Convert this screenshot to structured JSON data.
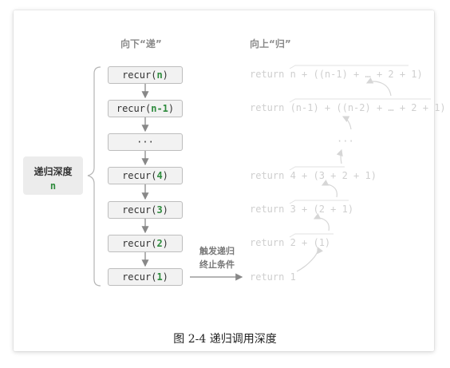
{
  "headers": {
    "down": "向下“递”",
    "up": "向上“归”"
  },
  "depth": {
    "label": "递归深度",
    "value": "n"
  },
  "calls": [
    {
      "prefix": "recur(",
      "arg": "n",
      "suffix": ")"
    },
    {
      "prefix": "recur(",
      "arg": "n-1",
      "suffix": ")"
    },
    {
      "prefix": "",
      "arg": "",
      "suffix": "···"
    },
    {
      "prefix": "recur(",
      "arg": "4",
      "suffix": ")"
    },
    {
      "prefix": "recur(",
      "arg": "3",
      "suffix": ")"
    },
    {
      "prefix": "recur(",
      "arg": "2",
      "suffix": ")"
    },
    {
      "prefix": "recur(",
      "arg": "1",
      "suffix": ")"
    }
  ],
  "returns": [
    "return n + ((n-1) + … + 2 + 1)",
    "return (n-1) + ((n-2) + … + 2 + 1)",
    "···",
    "return 4 + (3 + 2 + 1)",
    "return 3 + (2 + 1)",
    "return 2 + (1)",
    "return 1"
  ],
  "trigger": {
    "line1": "触发递归",
    "line2": "终止条件"
  },
  "caption": "图 2-4   递归调用深度",
  "colors": {
    "accent_green": "#2e8b3d",
    "box_fill": "#f2f2f2",
    "box_border": "#bdbdbd",
    "faded_text": "#cfcfcf",
    "arrow": "#888888"
  }
}
